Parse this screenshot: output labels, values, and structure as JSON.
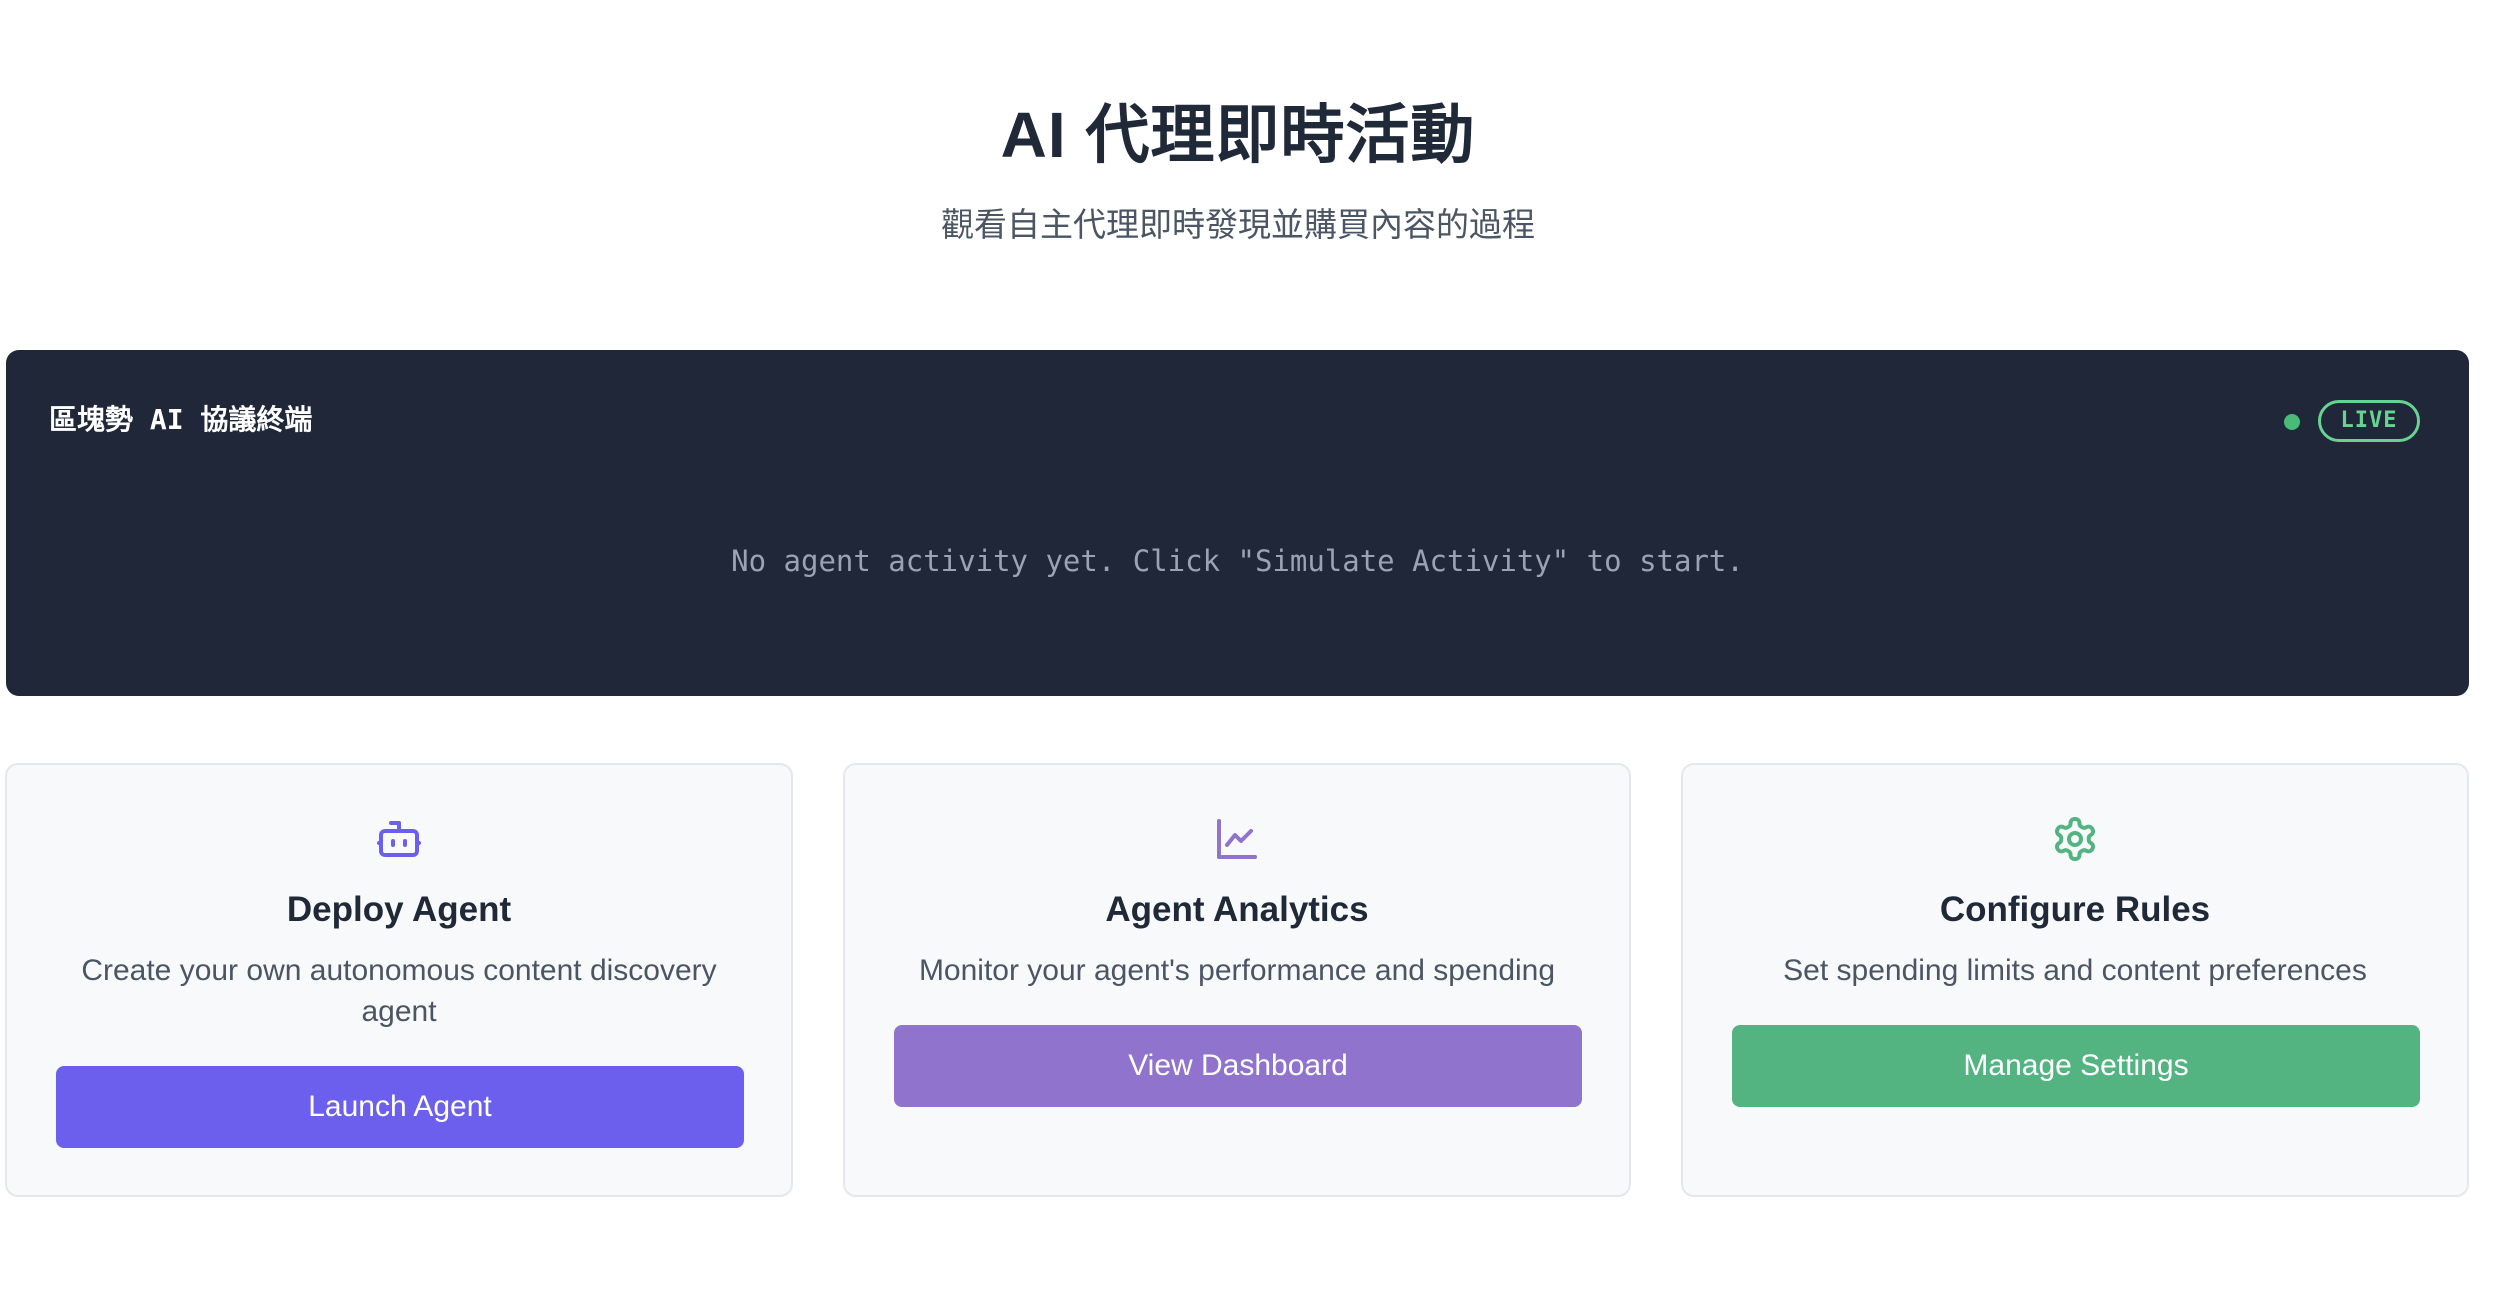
{
  "header": {
    "title": "AI 代理即時活動",
    "subtitle": "觀看自主代理即時發現並購買內容的過程"
  },
  "terminal": {
    "title": "區塊勢 AI 協議終端",
    "live_label": "LIVE",
    "empty_message": "No agent activity yet. Click \"Simulate Activity\" to start.",
    "colors": {
      "background": "#1f2739",
      "live": "#68d391"
    }
  },
  "cards": [
    {
      "icon": "robot-icon",
      "title": "Deploy Agent",
      "description": "Create your own autonomous content discovery agent",
      "button_label": "Launch Agent",
      "accent": "#6d5fee"
    },
    {
      "icon": "line-chart-icon",
      "title": "Agent Analytics",
      "description": "Monitor your agent's performance and spending",
      "button_label": "View Dashboard",
      "accent": "#8f73cc"
    },
    {
      "icon": "gear-icon",
      "title": "Configure Rules",
      "description": "Set spending limits and content preferences",
      "button_label": "Manage Settings",
      "accent": "#53b482"
    }
  ]
}
